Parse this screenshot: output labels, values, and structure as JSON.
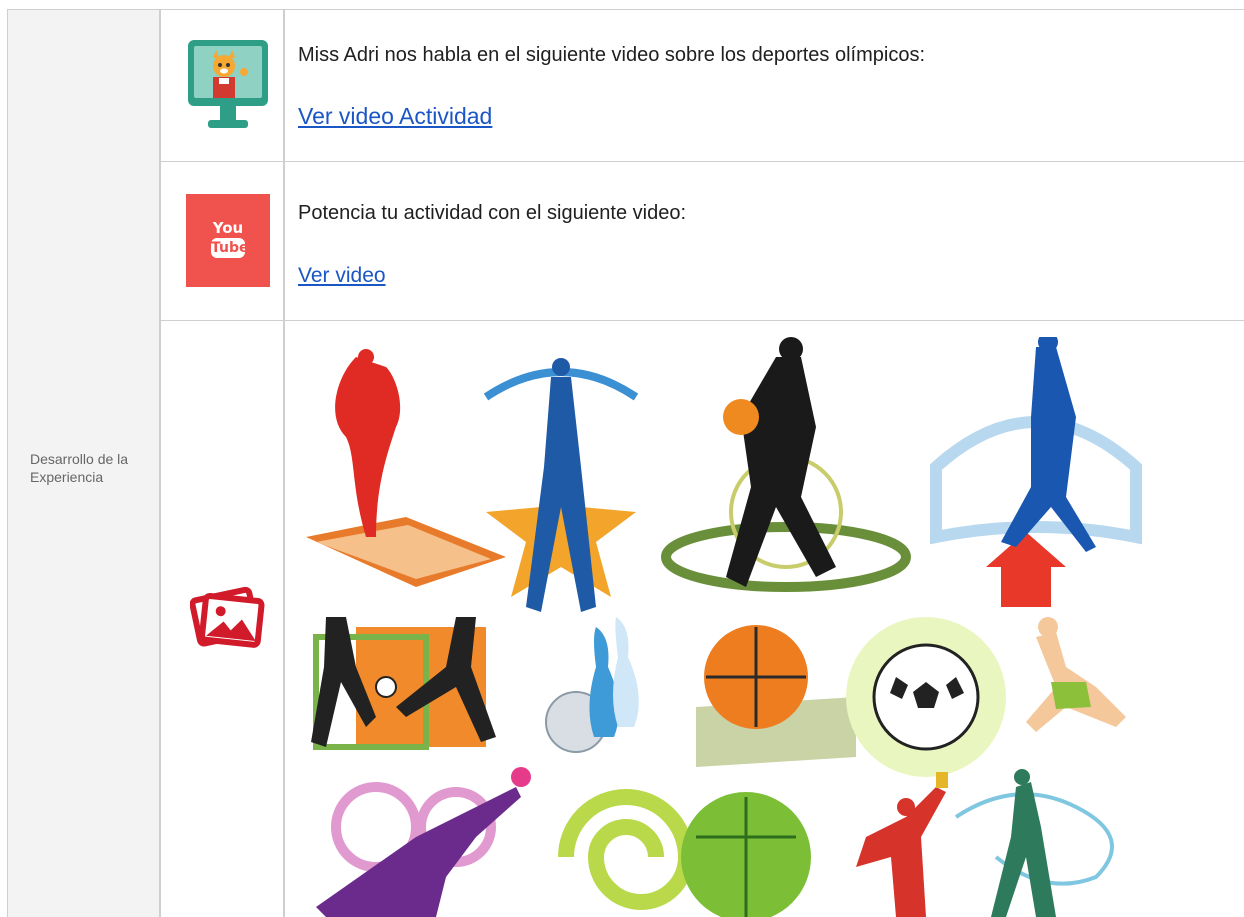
{
  "section_label": "Desarrollo de la Experiencia",
  "rows": [
    {
      "icon": "teacher-monitor-icon",
      "text": "Miss Adri nos habla en el siguiente video sobre los deportes olímpicos:",
      "link": "Ver video Actividad"
    },
    {
      "icon": "youtube-icon",
      "icon_text_top": "You",
      "icon_text_bottom": "Tube",
      "text": "Potencia tu actividad con el siguiente video:",
      "link": "Ver video"
    },
    {
      "icon": "image-gallery-icon",
      "image": "olympic-sports-collage"
    }
  ],
  "colors": {
    "link": "#1a56c4",
    "youtube_red": "#f0524e",
    "monitor_teal": "#2f9e86",
    "gallery_red": "#d11a2a",
    "border": "#cfcfcf",
    "label_bg": "#f3f3f3"
  }
}
